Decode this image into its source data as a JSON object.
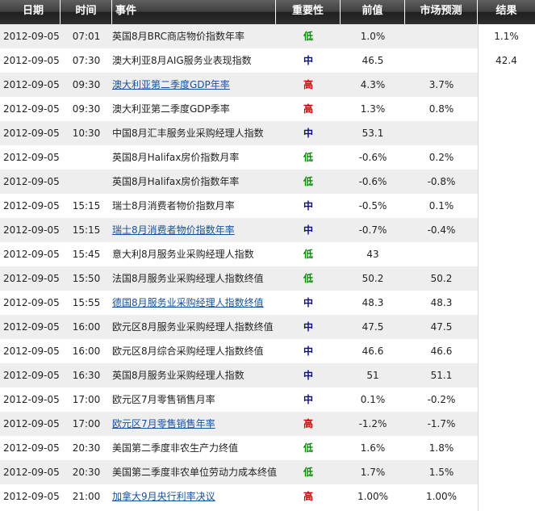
{
  "headers": {
    "date": "日期",
    "time": "时间",
    "event": "事件",
    "importance": "重要性",
    "previous": "前值",
    "forecast": "市场预测",
    "result": "结果"
  },
  "colors": {
    "header_bg": "#3a3a3a",
    "alt_row": "#eeeeee",
    "high": "#cc0000",
    "mid": "#0a0a8a",
    "low": "#0a8a0a",
    "link": "#1a4f9c"
  },
  "rows": [
    {
      "date": "2012-09-05",
      "time": "07:01",
      "event": "英国8月BRC商店物价指数年率",
      "link": false,
      "importance": "低",
      "level": "low",
      "previous": "1.0%",
      "forecast": "",
      "result": "1.1%"
    },
    {
      "date": "2012-09-05",
      "time": "07:30",
      "event": "澳大利亚8月AIG服务业表现指数",
      "link": false,
      "importance": "中",
      "level": "mid",
      "previous": "46.5",
      "forecast": "",
      "result": "42.4"
    },
    {
      "date": "2012-09-05",
      "time": "09:30",
      "event": "澳大利亚第二季度GDP年率",
      "link": true,
      "importance": "高",
      "level": "high",
      "previous": "4.3%",
      "forecast": "3.7%",
      "result": ""
    },
    {
      "date": "2012-09-05",
      "time": "09:30",
      "event": "澳大利亚第二季度GDP季率",
      "link": false,
      "importance": "高",
      "level": "high",
      "previous": "1.3%",
      "forecast": "0.8%",
      "result": ""
    },
    {
      "date": "2012-09-05",
      "time": "10:30",
      "event": "中国8月汇丰服务业采购经理人指数",
      "link": false,
      "importance": "中",
      "level": "mid",
      "previous": "53.1",
      "forecast": "",
      "result": ""
    },
    {
      "date": "2012-09-05",
      "time": "",
      "event": "英国8月Halifax房价指数月率",
      "link": false,
      "importance": "低",
      "level": "low",
      "previous": "-0.6%",
      "forecast": "0.2%",
      "result": ""
    },
    {
      "date": "2012-09-05",
      "time": "",
      "event": "英国8月Halifax房价指数年率",
      "link": false,
      "importance": "低",
      "level": "low",
      "previous": "-0.6%",
      "forecast": "-0.8%",
      "result": ""
    },
    {
      "date": "2012-09-05",
      "time": "15:15",
      "event": "瑞士8月消费者物价指数月率",
      "link": false,
      "importance": "中",
      "level": "mid",
      "previous": "-0.5%",
      "forecast": "0.1%",
      "result": ""
    },
    {
      "date": "2012-09-05",
      "time": "15:15",
      "event": "瑞士8月消费者物价指数年率",
      "link": true,
      "importance": "中",
      "level": "mid",
      "previous": "-0.7%",
      "forecast": "-0.4%",
      "result": ""
    },
    {
      "date": "2012-09-05",
      "time": "15:45",
      "event": "意大利8月服务业采购经理人指数",
      "link": false,
      "importance": "低",
      "level": "low",
      "previous": "43",
      "forecast": "",
      "result": ""
    },
    {
      "date": "2012-09-05",
      "time": "15:50",
      "event": "法国8月服务业采购经理人指数终值",
      "link": false,
      "importance": "低",
      "level": "low",
      "previous": "50.2",
      "forecast": "50.2",
      "result": ""
    },
    {
      "date": "2012-09-05",
      "time": "15:55",
      "event": "德国8月服务业采购经理人指数终值",
      "link": true,
      "importance": "中",
      "level": "mid",
      "previous": "48.3",
      "forecast": "48.3",
      "result": ""
    },
    {
      "date": "2012-09-05",
      "time": "16:00",
      "event": "欧元区8月服务业采购经理人指数终值",
      "link": false,
      "importance": "中",
      "level": "mid",
      "previous": "47.5",
      "forecast": "47.5",
      "result": ""
    },
    {
      "date": "2012-09-05",
      "time": "16:00",
      "event": "欧元区8月综合采购经理人指数终值",
      "link": false,
      "importance": "中",
      "level": "mid",
      "previous": "46.6",
      "forecast": "46.6",
      "result": ""
    },
    {
      "date": "2012-09-05",
      "time": "16:30",
      "event": "英国8月服务业采购经理人指数",
      "link": false,
      "importance": "中",
      "level": "mid",
      "previous": "51",
      "forecast": "51.1",
      "result": ""
    },
    {
      "date": "2012-09-05",
      "time": "17:00",
      "event": "欧元区7月零售销售月率",
      "link": false,
      "importance": "中",
      "level": "mid",
      "previous": "0.1%",
      "forecast": "-0.2%",
      "result": ""
    },
    {
      "date": "2012-09-05",
      "time": "17:00",
      "event": "欧元区7月零售销售年率",
      "link": true,
      "importance": "高",
      "level": "high",
      "previous": "-1.2%",
      "forecast": "-1.7%",
      "result": ""
    },
    {
      "date": "2012-09-05",
      "time": "20:30",
      "event": "美国第二季度非农生产力终值",
      "link": false,
      "importance": "低",
      "level": "low",
      "previous": "1.6%",
      "forecast": "1.8%",
      "result": ""
    },
    {
      "date": "2012-09-05",
      "time": "20:30",
      "event": "美国第二季度非农单位劳动力成本终值",
      "link": false,
      "importance": "低",
      "level": "low",
      "previous": "1.7%",
      "forecast": "1.5%",
      "result": ""
    },
    {
      "date": "2012-09-05",
      "time": "21:00",
      "event": "加拿大9月央行利率决议",
      "link": true,
      "importance": "高",
      "level": "high",
      "previous": "1.00%",
      "forecast": "1.00%",
      "result": ""
    }
  ]
}
